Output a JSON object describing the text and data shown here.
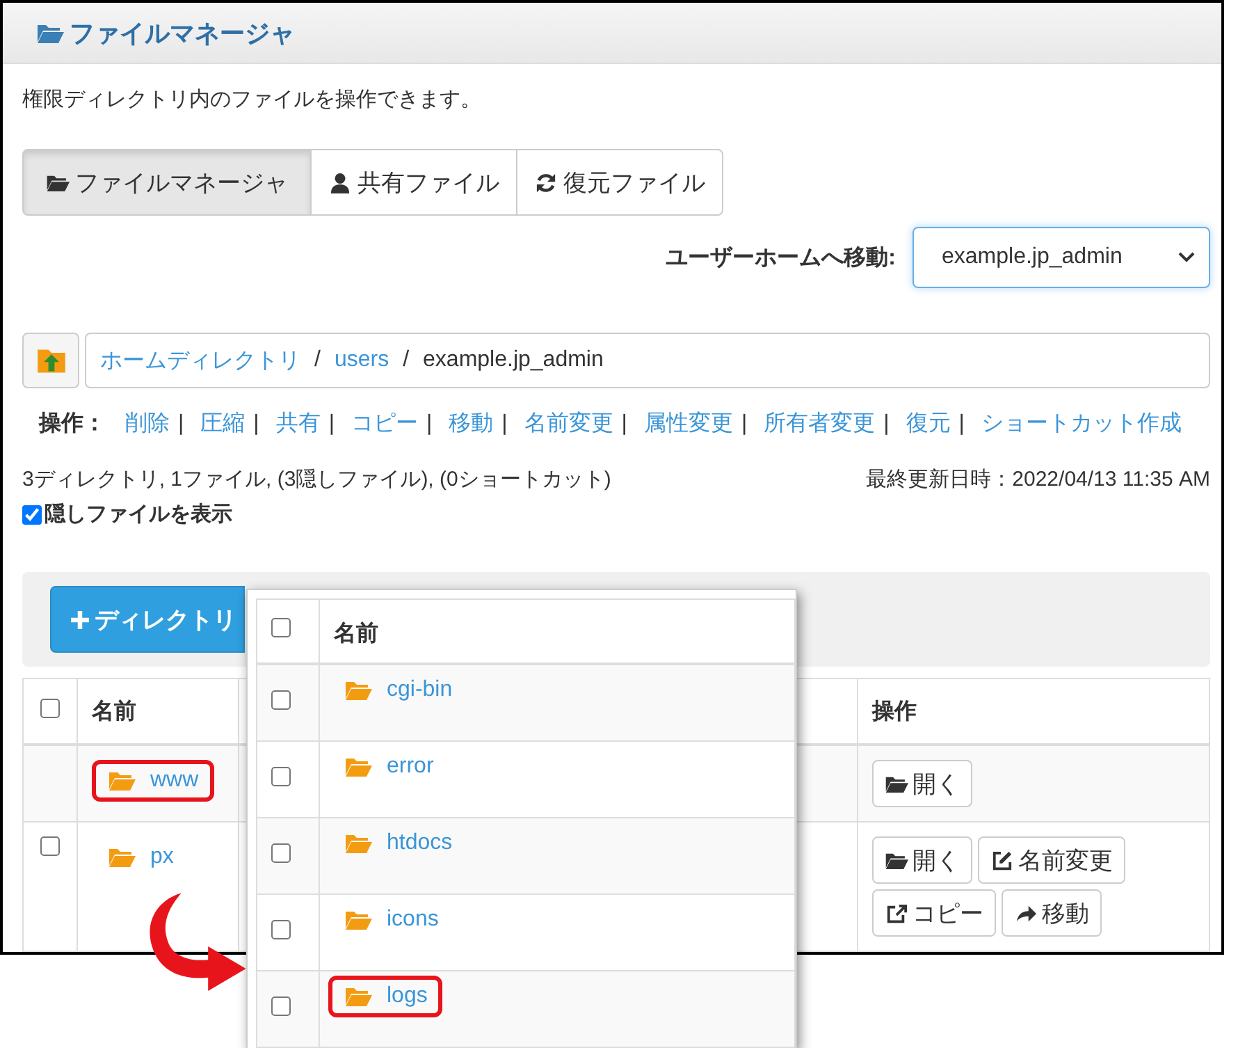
{
  "panel": {
    "title": "ファイルマネージャ",
    "description": "権限ディレクトリ内のファイルを操作できます。"
  },
  "tabs": [
    {
      "label": "ファイルマネージャ",
      "kind": "folder",
      "selected": true
    },
    {
      "label": "共有ファイル",
      "kind": "user",
      "selected": false
    },
    {
      "label": "復元ファイル",
      "kind": "refresh",
      "selected": false
    }
  ],
  "user_home": {
    "label": "ユーザーホームへ移動:",
    "value": "example.jp_admin"
  },
  "breadcrumb": {
    "separator": "/",
    "items": [
      {
        "label": "ホームディレクトリ",
        "link": true
      },
      {
        "label": "users",
        "link": true
      },
      {
        "label": "example.jp_admin",
        "link": false
      }
    ]
  },
  "actions": {
    "label": "操作：",
    "separator": "|",
    "items": [
      "削除",
      "圧縮",
      "共有",
      "コピー",
      "移動",
      "名前変更",
      "属性変更",
      "所有者変更",
      "復元",
      "ショートカット作成"
    ]
  },
  "summary": "3ディレクトリ, 1ファイル, (3隠しファイル), (0ショートカット)",
  "last_modified": "最終更新日時：2022/04/13 11:35 AM",
  "show_hidden": {
    "label": "隠しファイルを表示",
    "checked": true
  },
  "toolbar": {
    "new_directory": "ディレクトリ"
  },
  "table": {
    "select_all_checked": false,
    "columns": [
      "名前",
      "操作"
    ],
    "rows": [
      {
        "name": "www",
        "kind": "parent",
        "highlighted": true,
        "actions": [
          {
            "label": "開く",
            "kind": "open"
          }
        ]
      },
      {
        "name": "px",
        "kind": "item",
        "checked": false,
        "highlighted": false,
        "actions": [
          {
            "label": "開く",
            "kind": "open"
          },
          {
            "label": "名前変更",
            "kind": "rename"
          },
          {
            "label": "コピー",
            "kind": "copy"
          },
          {
            "label": "移動",
            "kind": "move"
          }
        ]
      }
    ]
  },
  "popup": {
    "select_all_checked": false,
    "columns": [
      "名前"
    ],
    "rows": [
      {
        "name": "cgi-bin",
        "checked": false,
        "highlighted": false
      },
      {
        "name": "error",
        "checked": false,
        "highlighted": false
      },
      {
        "name": "htdocs",
        "checked": false,
        "highlighted": false
      },
      {
        "name": "icons",
        "checked": false,
        "highlighted": false
      },
      {
        "name": "logs",
        "checked": false,
        "highlighted": true
      }
    ]
  }
}
